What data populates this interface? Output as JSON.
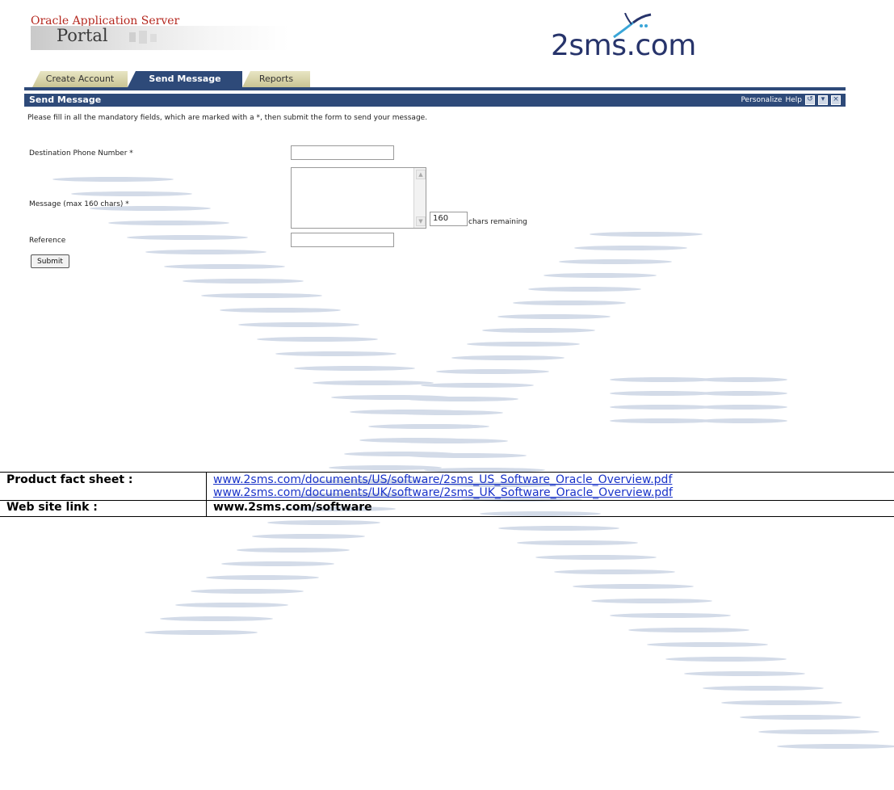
{
  "brand": {
    "title": "Oracle Application Server",
    "portal": "Portal"
  },
  "logo": {
    "text": "2sms.com"
  },
  "tabs": [
    {
      "label": "Create Account",
      "active": false
    },
    {
      "label": "Send Message",
      "active": true
    },
    {
      "label": "Reports",
      "active": false
    }
  ],
  "portlet": {
    "title": "Send Message",
    "personalize": "Personalize",
    "help": "Help"
  },
  "form": {
    "instructions": "Please fill in all the mandatory fields, which are marked with a *, then submit the form to send your message.",
    "destination_label": "Destination Phone Number *",
    "destination_value": "",
    "message_label": "Message (max 160 chars) *",
    "message_value": "",
    "chars_remaining_value": "160",
    "chars_remaining_label": "chars remaining",
    "reference_label": "Reference",
    "reference_value": "",
    "submit_label": "Submit"
  },
  "info": {
    "fact_sheet_label": "Product fact sheet :",
    "fact_sheet_links": [
      "www.2sms.com/documents/US/software/2sms_US_Software_Oracle_Overview.pdf",
      "www.2sms.com/documents/UK/software/2sms_UK_Software_Oracle_Overview.pdf"
    ],
    "website_label": "Web site link :",
    "website_value": "www.2sms.com/software"
  },
  "colors": {
    "header_blue": "#2e4a79",
    "tab_tan": "#c9c494",
    "link_blue": "#1a33c9",
    "brand_red": "#b5281f",
    "logo_navy": "#27346b",
    "watermark": "#d3dbe8"
  }
}
